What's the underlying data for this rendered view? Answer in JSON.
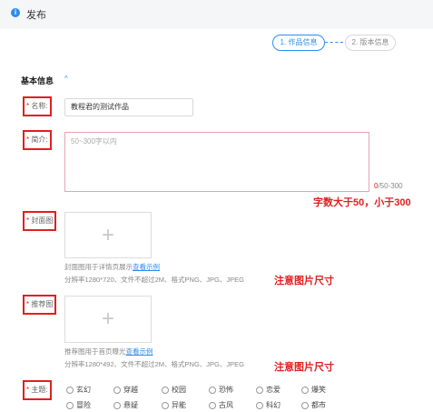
{
  "header": {
    "info_icon": "i",
    "title": "发布"
  },
  "steps": [
    {
      "label": "1. 作品信息",
      "active": true
    },
    {
      "label": "2. 版本信息",
      "active": false
    }
  ],
  "section": {
    "title": "基本信息",
    "collapse_icon": "chevron-up-icon",
    "collapse_glyph": "^"
  },
  "form": {
    "required_mark": "*",
    "name": {
      "label": "名称:",
      "value": "教程君的测试作品"
    },
    "intro": {
      "label": "简介:",
      "placeholder": "50~300字以内",
      "counter_current": "0",
      "counter_total": "/50-300",
      "annotation": "字数大于50，小于300"
    },
    "cover": {
      "label": "封面图",
      "plus": "+",
      "hint1_prefix": "封面图用于详情页展示",
      "hint1_link": "查看示例",
      "hint2": "分辨率1280*720、文件不超过2M、格式PNG、JPG、JPEG",
      "annotation": "注意图片尺寸"
    },
    "recommend": {
      "label": "推荐图",
      "plus": "+",
      "hint1_prefix": "推荐图用于首页曝光",
      "hint1_link": "查看示例",
      "hint2": "分辨率1280*492、文件不超过2M、格式PNG、JPG、JPEG",
      "annotation": "注意图片尺寸"
    },
    "theme": {
      "label": "主题:",
      "row1": [
        "玄幻",
        "穿越",
        "校园",
        "恐怖",
        "恋爱",
        "爆笑"
      ],
      "row2": [
        "冒险",
        "悬疑",
        "异能",
        "古风",
        "科幻",
        "都市"
      ]
    }
  },
  "colors": {
    "accent": "#2d8cf0",
    "required": "#e02020",
    "annotation": "#e02020"
  }
}
